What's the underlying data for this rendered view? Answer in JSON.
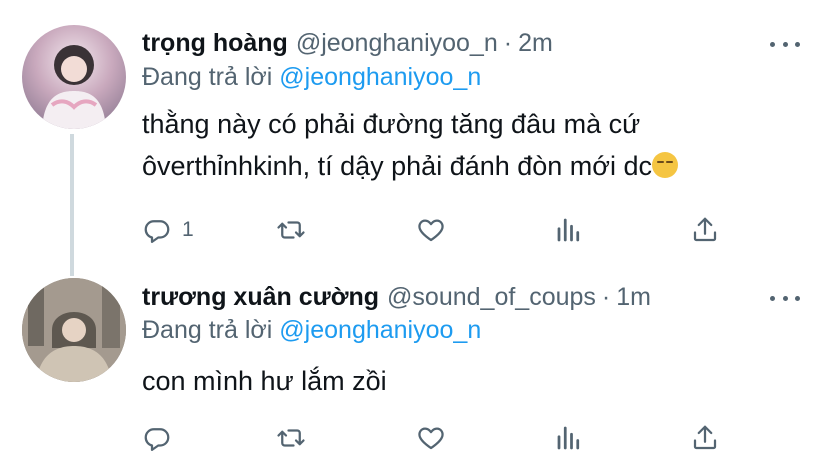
{
  "tweets": [
    {
      "name": "trọng hoàng",
      "handle": "@jeonghaniyoo_n",
      "separator": "·",
      "time": "2m",
      "reply_prefix": "Đang trả lời",
      "reply_handle": "@jeonghaniyoo_n",
      "text_line1": "thằng này có phải đường tăng đâu mà cứ",
      "text_line2": "ôverthỉnhkinh, tí dậy phải đánh đòn mới dc",
      "emoji": "pensive-face",
      "reply_count": "1"
    },
    {
      "name": "trương xuân cường",
      "handle": "@sound_of_coups",
      "separator": "·",
      "time": "1m",
      "reply_prefix": "Đang trả lời",
      "reply_handle": "@jeonghaniyoo_n",
      "text_line1": "con mình hư lắm zồi",
      "reply_count": ""
    }
  ],
  "colors": {
    "accent": "#1d9bf0",
    "secondary_text": "#536471",
    "primary_text": "#0f1419",
    "thread_line": "#cfd9de"
  },
  "icons": [
    "reply-icon",
    "retweet-icon",
    "like-icon",
    "analytics-icon",
    "share-icon",
    "more-icon"
  ]
}
